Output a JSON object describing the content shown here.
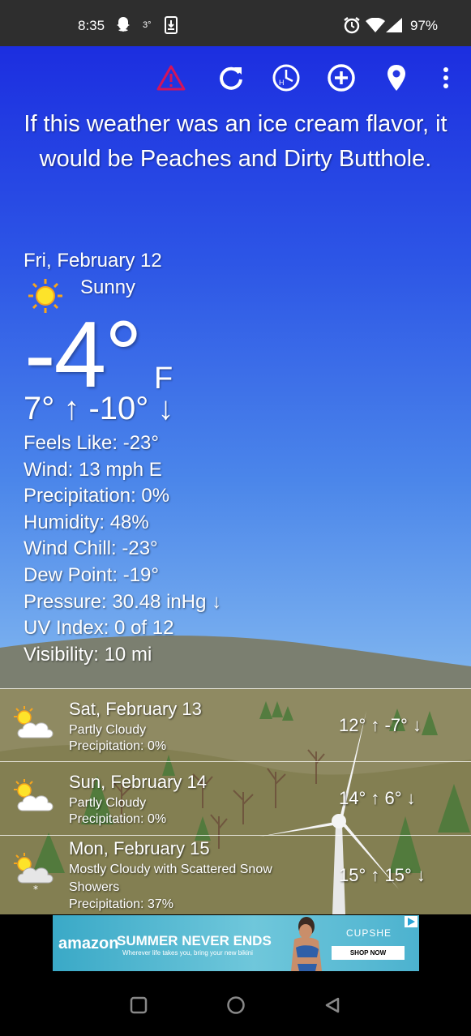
{
  "status_bar": {
    "time": "8:35",
    "temp_badge": "3°",
    "battery": "97%",
    "icons": [
      "snapchat-icon",
      "download-icon",
      "alarm-icon",
      "wifi-icon",
      "signal-icon"
    ]
  },
  "toolbar": {
    "icons": [
      "alert-icon",
      "refresh-icon",
      "history-clock-icon",
      "add-location-icon",
      "location-pin-icon",
      "overflow-menu-icon"
    ],
    "alert_color": "#d4145a"
  },
  "quote": "If this weather was an ice cream flavor, it would be Peaches and Dirty Butthole.",
  "current": {
    "date": "Fri, February 12",
    "condition": "Sunny",
    "icon": "sun-icon",
    "temp": "-4°",
    "unit": "F",
    "high_low": "7° ↑  -10° ↓",
    "details": [
      "Feels Like: -23°",
      "Wind: 13 mph E",
      "Precipitation: 0%",
      "Humidity: 48%",
      "Wind Chill: -23°",
      "Dew Point: -19°",
      "Pressure: 30.48 inHg ↓",
      "UV Index: 0 of 12",
      "Visibility: 10 mi"
    ]
  },
  "forecast": [
    {
      "day": "Sat, February 13",
      "condition": "Partly Cloudy",
      "precip": "Precipitation: 0%",
      "temps": "12° ↑  -7° ↓",
      "icon": "partly-cloudy-icon"
    },
    {
      "day": "Sun, February 14",
      "condition": "Partly Cloudy",
      "precip": "Precipitation: 0%",
      "temps": "14° ↑  6° ↓",
      "icon": "partly-cloudy-icon"
    },
    {
      "day": "Mon, February 15",
      "condition": "Mostly Cloudy with Scattered Snow Showers",
      "precip": "Precipitation: 37%",
      "temps": "15° ↑  15° ↓",
      "icon": "cloudy-snow-icon"
    }
  ],
  "ad": {
    "logo": "amazon",
    "headline": "SUMMER NEVER ENDS",
    "subline": "Wherever life takes you, bring your new bikini",
    "brand": "CUPSHE",
    "cta": "SHOP NOW"
  },
  "nav": {
    "icons": [
      "recents-square-icon",
      "home-circle-icon",
      "back-triangle-icon"
    ]
  }
}
